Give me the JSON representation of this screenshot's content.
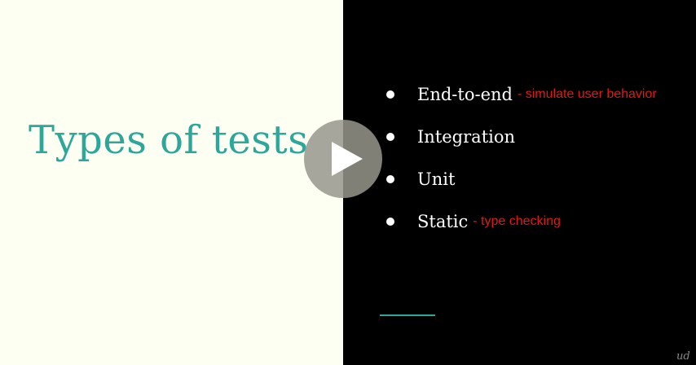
{
  "slide": {
    "title": "Types of tests",
    "bullets": [
      {
        "label": "End-to-end",
        "note": "- simulate user behavior"
      },
      {
        "label": "Integration",
        "note": ""
      },
      {
        "label": "Unit",
        "note": ""
      },
      {
        "label": "Static",
        "note": "- type checking"
      }
    ]
  },
  "player": {
    "play_icon": "play-icon"
  },
  "colors": {
    "title": "#2ea79b",
    "left_background": "#fefff3",
    "right_background": "#000000",
    "note": "#e01818",
    "accent_line": "#2ea79b"
  }
}
